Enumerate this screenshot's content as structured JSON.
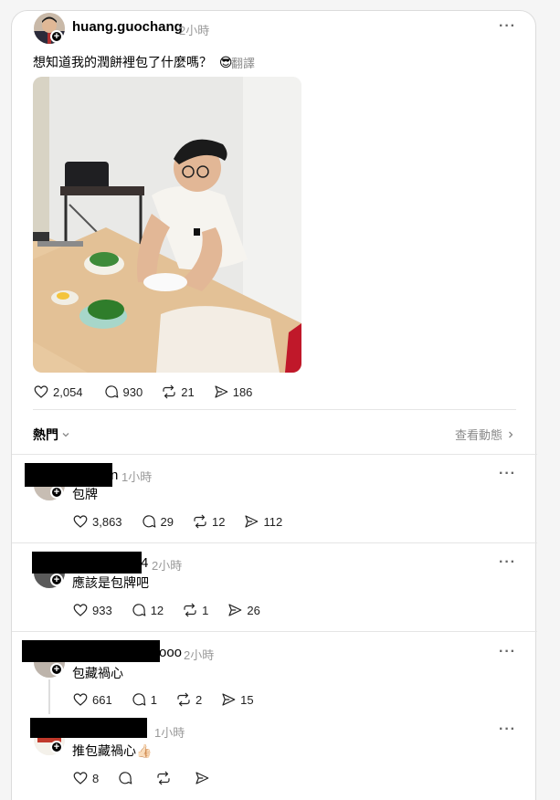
{
  "post": {
    "username": "huang.guochang",
    "time": "2小時",
    "text": "想知道我的潤餅裡包了什麼嗎？",
    "emoji": "😎",
    "translate_label": "翻譯",
    "more_label": "···",
    "likes": "2,054",
    "comments": "930",
    "reposts": "21",
    "shares": "186"
  },
  "feed": {
    "sort_label": "熱門",
    "activity_label": "查看動態"
  },
  "replies": [
    {
      "username_tail": "n",
      "time": "1小時",
      "text": "包牌",
      "likes": "3,863",
      "comments": "29",
      "reposts": "12",
      "shares": "112"
    },
    {
      "username_tail": "4",
      "time": "2小時",
      "text": "應該是包牌吧",
      "likes": "933",
      "comments": "12",
      "reposts": "1",
      "shares": "26"
    },
    {
      "username_tail": "ooo",
      "time": "2小時",
      "text": "包藏禍心",
      "likes": "661",
      "comments": "1",
      "reposts": "2",
      "shares": "15"
    },
    {
      "username_tail": "",
      "time": "1小時",
      "text": "推包藏禍心",
      "emoji": "👍🏻",
      "likes": "8",
      "comments": "",
      "reposts": "",
      "shares": ""
    }
  ],
  "icons": [
    "heart-icon",
    "comment-icon",
    "repost-icon",
    "share-icon",
    "more-icon",
    "chevron-down-icon",
    "chevron-right-icon",
    "follow-plus-icon"
  ]
}
